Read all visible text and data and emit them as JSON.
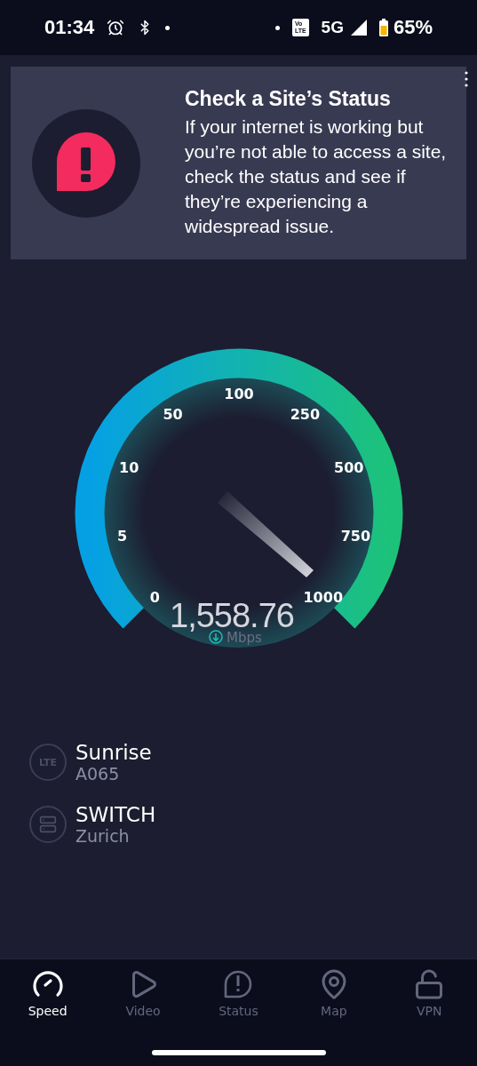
{
  "status_bar": {
    "time": "01:34",
    "volte": [
      "Vo",
      "LTE"
    ],
    "network": "5G",
    "battery": "65%"
  },
  "tip": {
    "title": "Check a Site’s Status",
    "body": "If your internet is working but you’re not able to access a site, check the status and see if they’re experiencing a widespread issue."
  },
  "gauge": {
    "ticks": [
      "0",
      "5",
      "10",
      "50",
      "100",
      "250",
      "500",
      "750",
      "1000"
    ],
    "value": "1,558.76",
    "unit": "Mbps"
  },
  "connections": [
    {
      "kind": "carrier",
      "badge": "LTE",
      "name": "Sunrise",
      "detail": "A065"
    },
    {
      "kind": "server",
      "name": "SWITCH",
      "detail": "Zurich"
    }
  ],
  "nav": [
    {
      "kind": "speed",
      "label": "Speed",
      "selected": true
    },
    {
      "kind": "video",
      "label": "Video",
      "selected": false
    },
    {
      "kind": "status",
      "label": "Status",
      "selected": false
    },
    {
      "kind": "map",
      "label": "Map",
      "selected": false
    },
    {
      "kind": "vpn",
      "label": "VPN",
      "selected": false
    }
  ]
}
